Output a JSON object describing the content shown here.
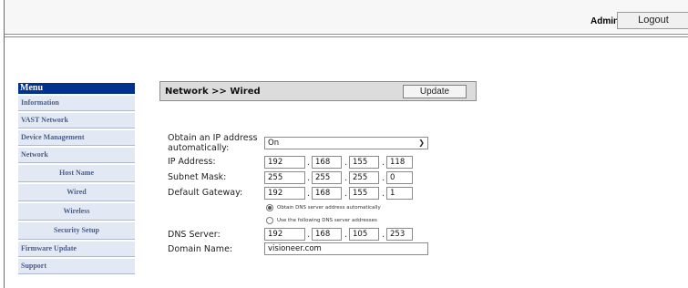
{
  "header": {
    "admin_label": "Admin",
    "logout_label": "Logout"
  },
  "menu": {
    "title": "Menu",
    "items": [
      {
        "label": "Information",
        "sub": false
      },
      {
        "label": "VAST Network",
        "sub": false
      },
      {
        "label": "Device Management",
        "sub": false
      },
      {
        "label": "Network",
        "sub": false
      },
      {
        "label": "Host Name",
        "sub": true
      },
      {
        "label": "Wired",
        "sub": true
      },
      {
        "label": "Wireless",
        "sub": true
      },
      {
        "label": "Security Setup",
        "sub": true
      },
      {
        "label": "Firmware Update",
        "sub": false
      },
      {
        "label": "Support",
        "sub": false
      }
    ]
  },
  "panel": {
    "title": "Network >> Wired",
    "update_label": "Update"
  },
  "form": {
    "obtain_label_line1": "Obtain an IP address",
    "obtain_label_line2": "automatically:",
    "obtain_value": "On",
    "ip_label": "IP Address:",
    "ip": [
      "192",
      "168",
      "155",
      "118"
    ],
    "subnet_label": "Subnet Mask:",
    "subnet": [
      "255",
      "255",
      "255",
      "0"
    ],
    "gateway_label": "Default Gateway:",
    "gateway": [
      "192",
      "168",
      "155",
      "1"
    ],
    "dns_auto_label": "Obtain DNS server address automatically",
    "dns_manual_label": "Use the following DNS server addresses",
    "dns_label": "DNS Server:",
    "dns": [
      "192",
      "168",
      "105",
      "253"
    ],
    "domain_label": "Domain Name:",
    "domain_value": "visioneer.com"
  }
}
